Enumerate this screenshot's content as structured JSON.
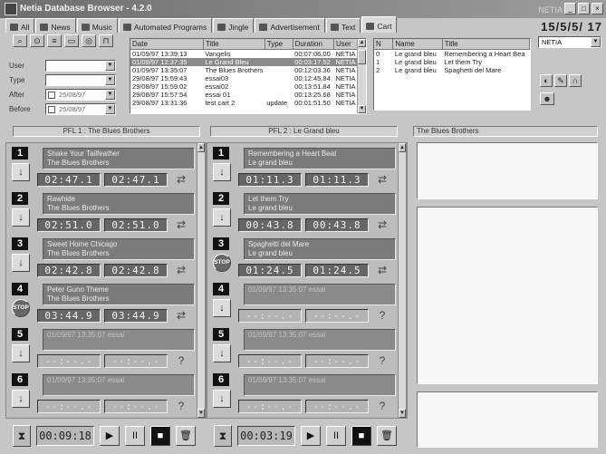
{
  "window": {
    "title": "Netia Database Browser - 4.2.0",
    "info": "NETIA"
  },
  "tabs": [
    {
      "label": "All"
    },
    {
      "label": "News"
    },
    {
      "label": "Music"
    },
    {
      "label": "Automated Programs"
    },
    {
      "label": "Jingle"
    },
    {
      "label": "Advertisement"
    },
    {
      "label": "Text"
    },
    {
      "label": "Cart"
    }
  ],
  "top_right_label": "15/5/5/ 17",
  "filters": {
    "user_label": "User",
    "type_label": "Type",
    "after_label": "After",
    "before_label": "Before",
    "after_value": "25/08/97",
    "before_value": "25/08/97"
  },
  "main_list": {
    "columns": [
      "Date",
      "Title",
      "Type",
      "Duration",
      "User"
    ],
    "rows": [
      {
        "date": "01/09/97 13:39:13",
        "title": "Vangelis",
        "type": "",
        "duration": "00:07:06.00",
        "user": "NETIA"
      },
      {
        "date": "01/09/97 12:37:35",
        "title": "Le Grand Bleu",
        "type": "",
        "duration": "00:03:17.52",
        "user": "NETIA"
      },
      {
        "date": "01/09/97 13:35:07",
        "title": "The Blues Brothers",
        "type": "",
        "duration": "00:12:03.36",
        "user": "NETIA"
      },
      {
        "date": "29/08/97 15:59:43",
        "title": "essai03",
        "type": "",
        "duration": "00:12:45.84",
        "user": "NETIA"
      },
      {
        "date": "29/08/97 15:59:02",
        "title": "essai02",
        "type": "",
        "duration": "00:13:51.84",
        "user": "NETIA"
      },
      {
        "date": "29/08/97 15:57:54",
        "title": "essai 01",
        "type": "",
        "duration": "00:13:25.68",
        "user": "NETIA"
      },
      {
        "date": "29/08/97 13:31:36",
        "title": "test cart 2",
        "type": "update",
        "duration": "00:01:51.50",
        "user": "NETIA"
      }
    ]
  },
  "cart_contents": {
    "columns": [
      "N",
      "Name",
      "Title"
    ],
    "rows": [
      {
        "n": "0",
        "name": "Le grand bleu",
        "title": "Remembering a Heart Bea"
      },
      {
        "n": "1",
        "name": "Le grand bleu",
        "title": "Let them Try"
      },
      {
        "n": "2",
        "name": "Le grand bleu",
        "title": "Spaghetti del Mare"
      }
    ]
  },
  "right_panel": {
    "select_value": "NETIA"
  },
  "player1": {
    "header": "PFL 1 : The Blues Brothers",
    "slots": [
      {
        "num": "1",
        "title": "Shake Your Tailfeather",
        "artist": "The Blues Brothers",
        "t1": "02:47.1",
        "t2": "02:47.1",
        "btn": "↓",
        "dim": false
      },
      {
        "num": "2",
        "title": "Rawhide",
        "artist": "The Blues Brothers",
        "t1": "02:51.0",
        "t2": "02:51.0",
        "btn": "↓",
        "dim": false
      },
      {
        "num": "3",
        "title": "Sweet Home Chicago",
        "artist": "The Blues Brothers",
        "t1": "02:42.8",
        "t2": "02:42.8",
        "btn": "↓",
        "dim": false
      },
      {
        "num": "4",
        "title": "Peter Gunn Theme",
        "artist": "The Blues Brothers",
        "t1": "03:44.9",
        "t2": "03:44.9",
        "btn": "STOP",
        "dim": false
      },
      {
        "num": "5",
        "title": "01/09/97 13:35:07 essai",
        "artist": "",
        "t1": "--:--.-",
        "t2": "--:--.-",
        "btn": "↓",
        "dim": true
      },
      {
        "num": "6",
        "title": "01/09/97 13:35:07 essai",
        "artist": "",
        "t1": "--:--.-",
        "t2": "--:--.-",
        "btn": "↓",
        "dim": true
      }
    ],
    "counter": "00:09:18"
  },
  "player2": {
    "header": "PFL 2 : Le Grand bleu",
    "slots": [
      {
        "num": "1",
        "title": "Remembering a Heart Beat",
        "artist": "Le grand bleu",
        "t1": "01:11.3",
        "t2": "01:11.3",
        "btn": "↓",
        "dim": false
      },
      {
        "num": "2",
        "title": "Let them Try",
        "artist": "Le grand bleu",
        "t1": "00:43.8",
        "t2": "00:43.8",
        "btn": "↓",
        "dim": false
      },
      {
        "num": "3",
        "title": "Spaghetti del Mare",
        "artist": "Le grand bleu",
        "t1": "01:24.5",
        "t2": "01:24.5",
        "btn": "STOP",
        "dim": false
      },
      {
        "num": "4",
        "title": "01/09/97 13:35:07 essai",
        "artist": "",
        "t1": "--:--.-",
        "t2": "--:--.-",
        "btn": "↓",
        "dim": true
      },
      {
        "num": "5",
        "title": "01/09/97 13:35:07 essai",
        "artist": "",
        "t1": "--:--.-",
        "t2": "--:--.-",
        "btn": "↓",
        "dim": true
      },
      {
        "num": "6",
        "title": "01/09/97 13:35:07 essai",
        "artist": "",
        "t1": "--:--.-",
        "t2": "--:--.-",
        "btn": "↓",
        "dim": true
      }
    ],
    "counter": "00:03:19"
  },
  "preview_header": "The Blues Brothers",
  "transport_buttons": [
    "▶",
    "II",
    "■",
    "🗑"
  ]
}
